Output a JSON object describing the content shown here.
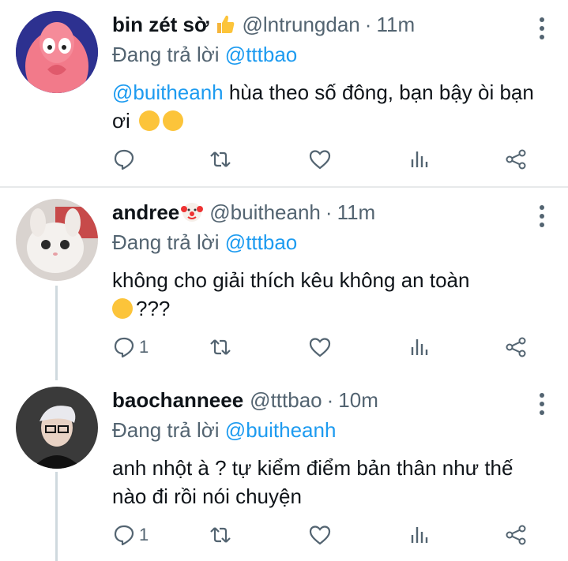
{
  "tweets": [
    {
      "name": "bin zét sờ",
      "badge_icon": "thumbs-up-emoji",
      "handle": "@lntrungdan",
      "time": "11m",
      "reply_prefix": "Đang trả lời",
      "reply_to": "@tttbao",
      "mention": "@buitheanh",
      "text": " hùa theo số đông, bạn bậy òi bạn ơi",
      "reply_count": ""
    },
    {
      "name": "andree",
      "badge_icon": "clown-emoji",
      "handle": "@buitheanh",
      "time": "11m",
      "reply_prefix": "Đang trả lời",
      "reply_to": "@tttbao",
      "text_line1": "không cho giải thích kêu không an toàn",
      "text_line2": "???",
      "reply_count": "1"
    },
    {
      "name": "baochanneee",
      "handle": "@tttbao",
      "time": "10m",
      "reply_prefix": "Đang trả lời",
      "reply_to": "@buitheanh",
      "text": "anh nhột à ? tự kiểm điểm bản thân như thế nào đi rồi nói chuyện",
      "reply_count": "1"
    }
  ],
  "colors": {
    "link": "#1d9bf0",
    "muted": "#536471",
    "separator": "#e7e9ea",
    "thread_line": "#cfd9de"
  }
}
